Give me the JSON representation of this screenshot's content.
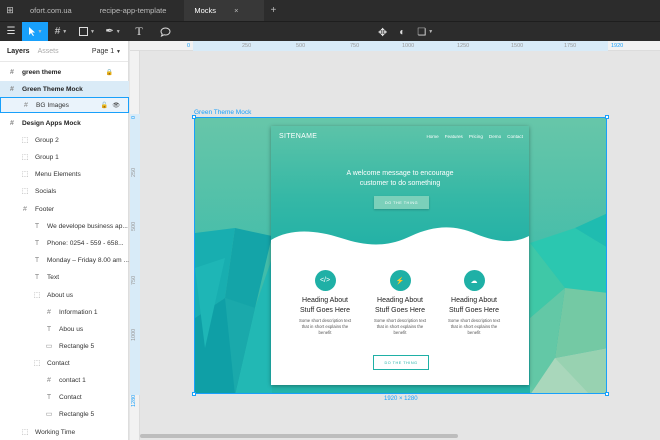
{
  "tabs": [
    {
      "label": "ofort.com.ua"
    },
    {
      "label": "recipe-app-template"
    },
    {
      "label": "Mocks"
    }
  ],
  "panel": {
    "layers_tab": "Layers",
    "assets_tab": "Assets",
    "page_label": "Page 1"
  },
  "layers": [
    {
      "label": "green theme"
    },
    {
      "label": "Green Theme Mock"
    },
    {
      "label": "BG Images"
    },
    {
      "label": "Design Apps Mock"
    },
    {
      "label": "Group 2"
    },
    {
      "label": "Group 1"
    },
    {
      "label": "Menu Elements"
    },
    {
      "label": "Socials"
    },
    {
      "label": "Footer"
    },
    {
      "label": "We develope business ap..."
    },
    {
      "label": "Phone: 0254 - 559 - 658..."
    },
    {
      "label": "Monday – Friday 8.00 am ..."
    },
    {
      "label": "Text"
    },
    {
      "label": "About us"
    },
    {
      "label": "Information 1"
    },
    {
      "label": "Abou us"
    },
    {
      "label": "Rectangle 5"
    },
    {
      "label": "Contact"
    },
    {
      "label": "contact 1"
    },
    {
      "label": "Contact"
    },
    {
      "label": "Rectangle 5"
    },
    {
      "label": "Working Time"
    }
  ],
  "ruler": {
    "top": [
      "0",
      "250",
      "500",
      "750",
      "1000",
      "1250",
      "1500",
      "1750",
      "1920"
    ],
    "left": [
      "0",
      "250",
      "500",
      "750",
      "1000",
      "1280"
    ]
  },
  "frame": {
    "name": "Green Theme Mock",
    "size": "1920 × 1280"
  },
  "mock": {
    "sitename": "SITENAME",
    "nav": [
      "Home",
      "Features",
      "Pricing",
      "Demo",
      "Contact"
    ],
    "welcome_line1": "A welcome message to encourage",
    "welcome_line2": "customer to do something",
    "hero_button": "DO THE THING",
    "features": [
      {
        "icon": "code-icon",
        "title1": "Heading About",
        "title2": "Stuff Goes Here",
        "desc1": "Some short description text",
        "desc2": "that in short explains the",
        "desc3": "benefit"
      },
      {
        "icon": "bolt-icon",
        "title1": "Heading About",
        "title2": "Stuff Goes Here",
        "desc1": "Some short description text",
        "desc2": "that in short explains the",
        "desc3": "benefit"
      },
      {
        "icon": "cloud-icon",
        "title1": "Heading About",
        "title2": "Stuff Goes Here",
        "desc1": "Some short description text",
        "desc2": "that in short explains the",
        "desc3": "benefit"
      }
    ],
    "bottom_button": "DO THE THING"
  },
  "colors": {
    "accent": "#18a0fb",
    "teal": "#1fb0a6",
    "toolbar": "#2c2c2c"
  }
}
